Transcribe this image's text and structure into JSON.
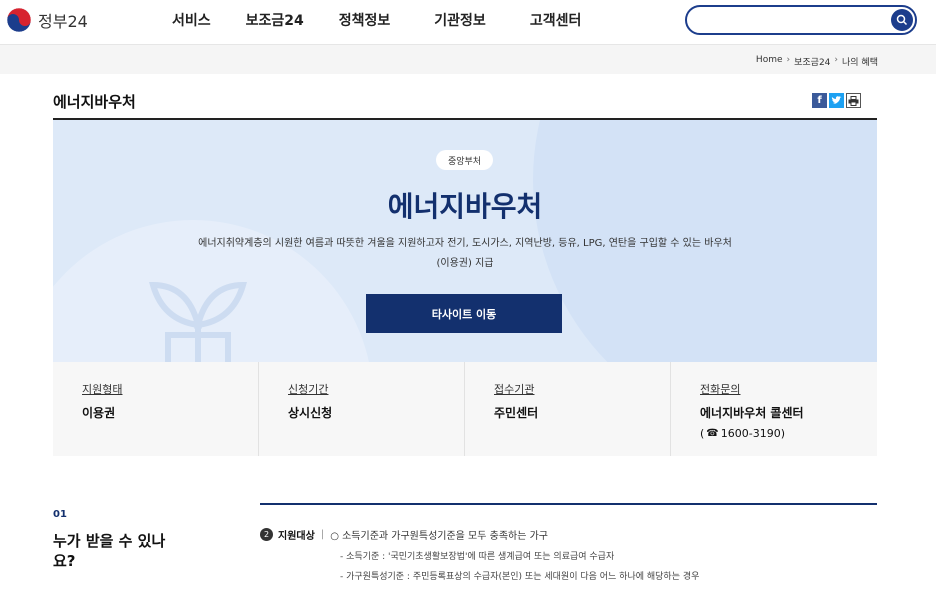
{
  "header": {
    "logo_text": "정부24",
    "nav": [
      "서비스",
      "보조금24",
      "정책정보",
      "기관정보",
      "고객센터"
    ],
    "search_placeholder": ""
  },
  "breadcrumb": [
    "Home",
    "보조금24",
    "나의 혜택"
  ],
  "page": {
    "title": "에너지바우처",
    "share": [
      "f",
      "t",
      "print"
    ]
  },
  "hero": {
    "badge": "중앙부처",
    "title": "에너지바우처",
    "desc_line1": "에너지취약계층의 시원한 여름과 따뜻한 겨울을 지원하고자 전기, 도시가스, 지역난방, 등유, LPG, 연탄을 구입할 수 있는 바우처",
    "desc_line2": "(이용권) 지급",
    "button": "타사이트 이동"
  },
  "info": [
    {
      "label": "지원형태",
      "value": "이용권"
    },
    {
      "label": "신청기간",
      "value": "상시신청"
    },
    {
      "label": "접수기관",
      "value": "주민센터"
    },
    {
      "label": "전화문의",
      "value": "에너지바우처 콜센터",
      "sub": "1600-3190"
    }
  ],
  "section": {
    "num": "01",
    "title": "누가 받을 수 있나요?",
    "target_num": "2",
    "target_label": "지원대상",
    "target_sep": "|",
    "line1": "○ 소득기준과 가구원특성기준을 모두 충족하는 가구",
    "line2": "- 소득기준 : '국민기초생활보장법'에 따른 생계급여 또는 의료급여 수급자",
    "line3": "- 가구원특성기준 : 주민등록표상의 수급자(본인) 또는 세대원이 다음 어느 하나에 해당하는 경우"
  },
  "colors": {
    "primary": "#13306e",
    "hero_bg": "#dde9f8",
    "info_bg": "#f7f7f7"
  }
}
